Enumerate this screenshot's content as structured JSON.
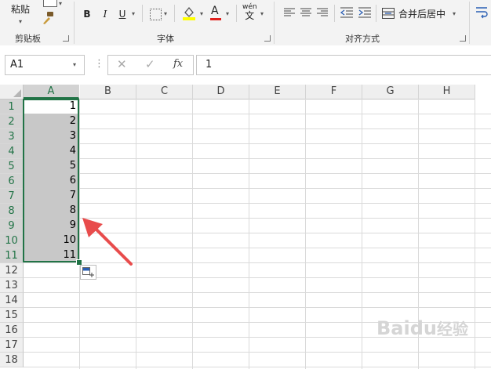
{
  "ribbon": {
    "paste_label": "粘贴",
    "bold": "B",
    "italic": "I",
    "underline": "U",
    "phonetic_top": "wén",
    "phonetic_bottom": "文",
    "merge_label": "合并后居中",
    "group_clipboard": "剪贴板",
    "group_font": "字体",
    "group_align": "对齐方式",
    "font_color": "#e0201c",
    "fill_color": "#ffff00"
  },
  "formula_bar": {
    "name_box": "A1",
    "fx": "fx",
    "value": "1"
  },
  "grid": {
    "columns": [
      "A",
      "B",
      "C",
      "D",
      "E",
      "F",
      "G",
      "H"
    ],
    "rows": [
      "1",
      "2",
      "3",
      "4",
      "5",
      "6",
      "7",
      "8",
      "9",
      "10",
      "11",
      "12",
      "13",
      "14",
      "15",
      "16",
      "17",
      "18"
    ],
    "values": [
      "1",
      "2",
      "3",
      "4",
      "5",
      "6",
      "7",
      "8",
      "9",
      "10",
      "11"
    ],
    "selection_color": "#217346",
    "arrow_color": "#e84c4c"
  },
  "watermark": {
    "brand": "Baidu",
    "suffix": "经验"
  }
}
